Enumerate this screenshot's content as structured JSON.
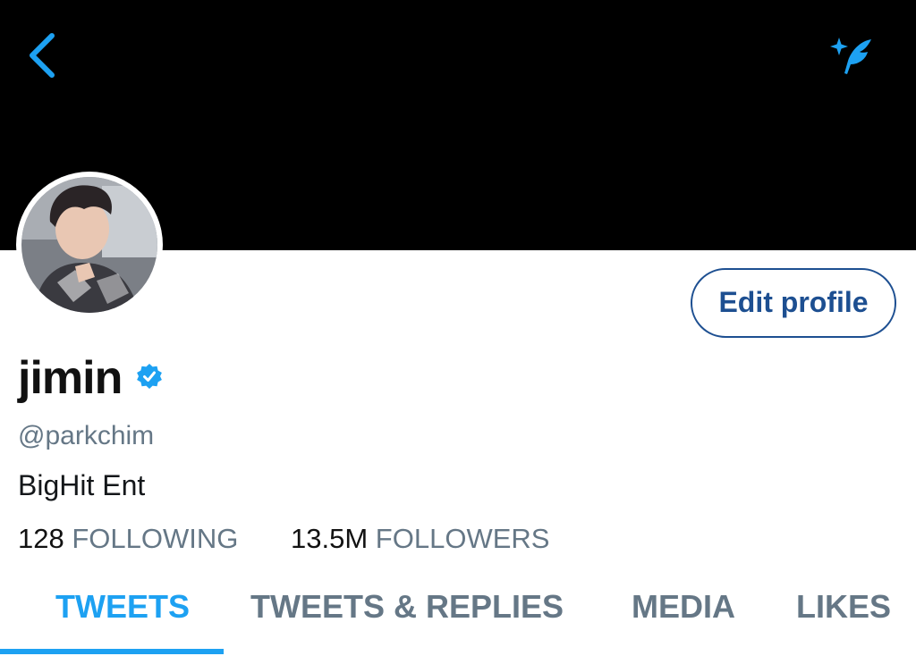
{
  "header": {
    "back_icon": "chevron-left-icon",
    "compose_icon": "compose-tweet-icon",
    "accent_color": "#1da1f2"
  },
  "profile": {
    "avatar_icon": "avatar-photo",
    "edit_button_label": "Edit profile",
    "display_name": "jimin",
    "verified_icon": "verified-badge-icon",
    "handle": "@parkchim",
    "bio": "BigHit Ent",
    "following_count": "128",
    "following_label": "FOLLOWING",
    "followers_count": "13.5M",
    "followers_label": "FOLLOWERS"
  },
  "tabs": [
    {
      "label": "TWEETS",
      "active": true
    },
    {
      "label": "TWEETS & REPLIES",
      "active": false
    },
    {
      "label": "MEDIA",
      "active": false
    },
    {
      "label": "LIKES",
      "active": false
    }
  ],
  "colors": {
    "accent": "#1da1f2",
    "edit_button": "#1d4f91",
    "secondary_text": "#657786",
    "header_background": "#000000"
  }
}
